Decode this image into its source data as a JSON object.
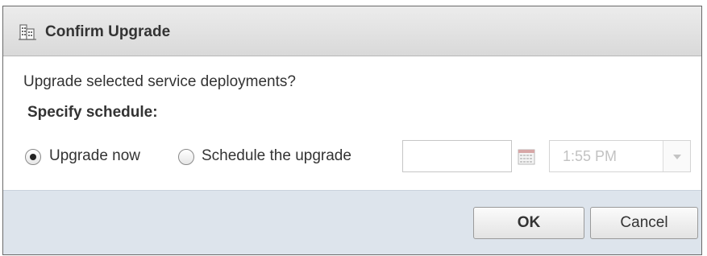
{
  "dialog": {
    "title": "Confirm Upgrade",
    "title_icon": "building-icon",
    "question": "Upgrade selected service deployments?",
    "schedule_label": "Specify schedule:",
    "options": [
      {
        "label": "Upgrade now",
        "checked": true
      },
      {
        "label": "Schedule the upgrade",
        "checked": false
      }
    ],
    "date_value": "",
    "calendar_icon": "calendar-icon",
    "time_value": "1:55 PM",
    "buttons": {
      "ok": "OK",
      "cancel": "Cancel"
    }
  },
  "colors": {
    "titlebar": "#e3e3e3",
    "footer": "#dde4ec",
    "background_link_text": "#1f6fc5"
  }
}
